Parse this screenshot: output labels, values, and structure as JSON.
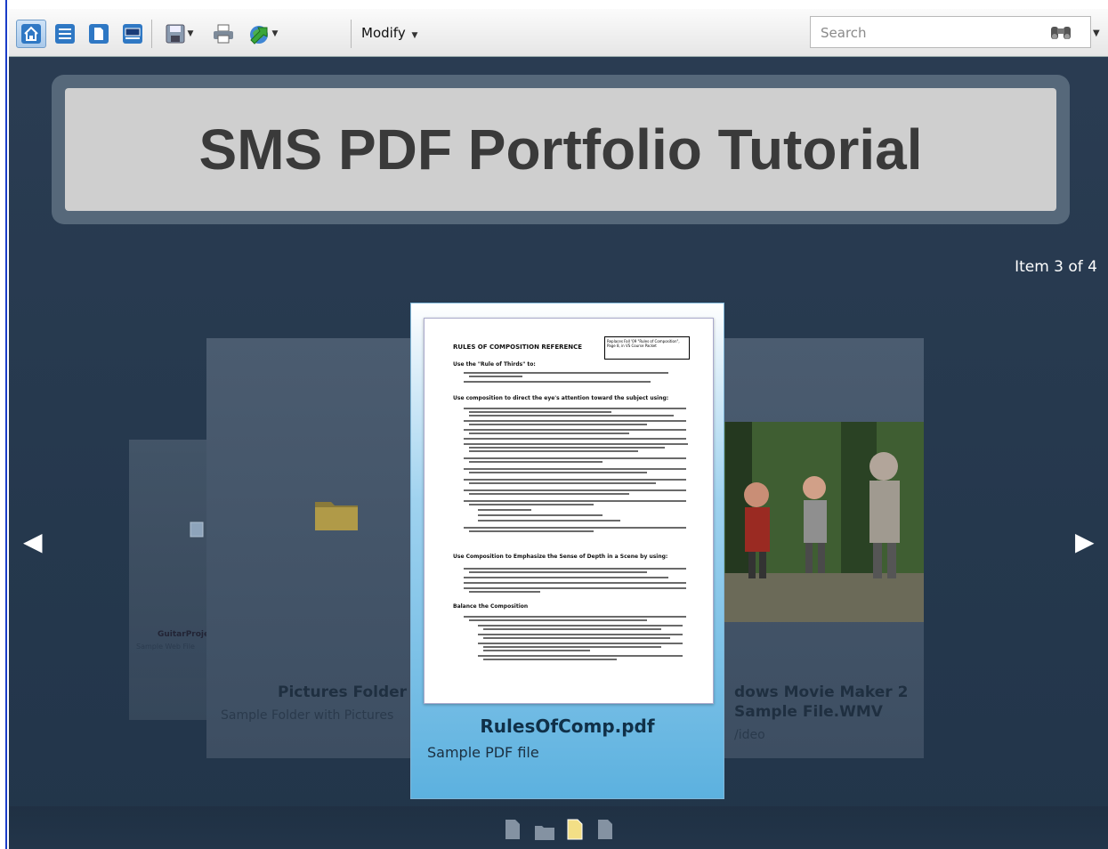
{
  "toolbar": {
    "buttons": [
      "home-icon",
      "details-view-icon",
      "file-view-icon",
      "cover-view-icon",
      "save-icon",
      "print-icon",
      "share-icon"
    ],
    "modify_label": "Modify"
  },
  "search": {
    "placeholder": "Search"
  },
  "title": "SMS PDF Portfolio Tutorial",
  "item_counter": "Item 3 of 4",
  "navigation": {
    "prev": "◀",
    "next": "▶"
  },
  "cards": {
    "far_left": {
      "name": "GuitarProje...",
      "desc": "Sample Web File"
    },
    "left": {
      "name": "Pictures Folder",
      "desc": "Sample Folder with Pictures"
    },
    "center": {
      "name": "RulesOfComp.pdf",
      "desc": "Sample PDF file"
    },
    "right": {
      "name_line1": "dows Movie Maker 2",
      "name_line2": "Sample File.WMV",
      "desc": "/ideo"
    }
  },
  "document": {
    "heading": "RULES OF COMPOSITION REFERENCE",
    "box_note": "Replaces Fall '09 \"Rules of Composition\", Page 8, in VS Course Packet",
    "section1": "Use the \"Rule of Thirds\" to:",
    "section2": "Use composition to direct the eye's attention toward the subject using:",
    "section3": "Use Composition to Emphasize the Sense of Depth in a Scene by using:",
    "section4": "Balance the Composition"
  },
  "pager": {
    "total": 4,
    "current": 3
  },
  "colors": {
    "background": "#25384d",
    "selected_card": "#5cb1df",
    "accent_arrow": "#ffffff"
  }
}
